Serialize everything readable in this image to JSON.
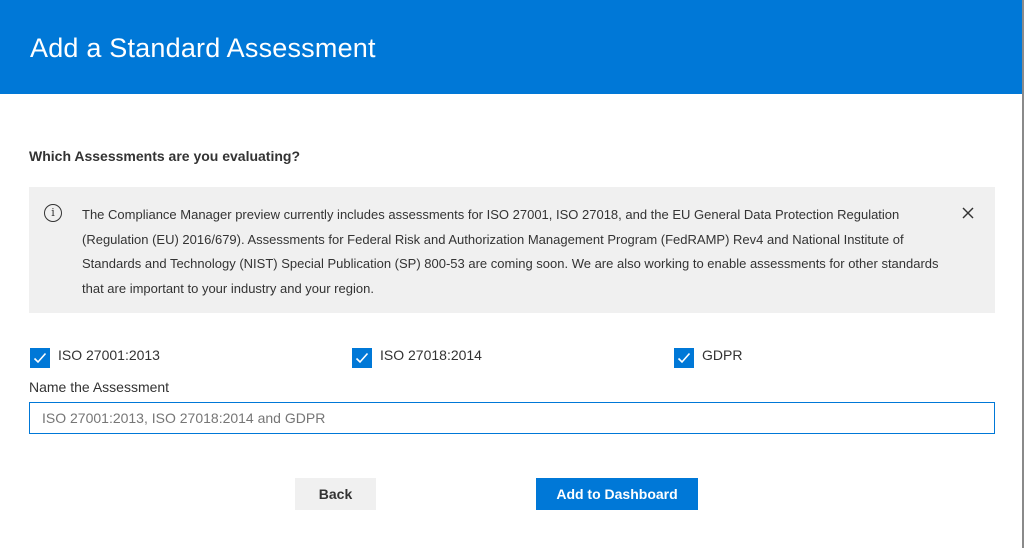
{
  "dialog": {
    "title": "Add a Standard Assessment"
  },
  "question": "Which Assessments are you evaluating?",
  "info_banner": {
    "icon": "info-icon",
    "text": "The Compliance Manager preview currently includes assessments for ISO 27001, ISO 27018, and the EU General Data Protection Regulation (Regulation (EU) 2016/679). Assessments for Federal Risk and Authorization Management Program (FedRAMP) Rev4 and National Institute of Standards and Technology (NIST) Special Publication (SP) 800-53 are coming soon. We are also working to enable assessments for other standards that are important to your industry and your region.",
    "close_icon": "close-icon"
  },
  "assessments": [
    {
      "label": "ISO 27001:2013",
      "checked": true
    },
    {
      "label": "ISO 27018:2014",
      "checked": true
    },
    {
      "label": "GDPR",
      "checked": true
    }
  ],
  "name_field": {
    "label": "Name the Assessment",
    "placeholder": "ISO 27001:2013, ISO 27018:2014 and GDPR",
    "value": ""
  },
  "buttons": {
    "back_label": "Back",
    "add_label": "Add to Dashboard"
  },
  "colors": {
    "accent": "#0078d7",
    "panel": "#f0f0f0",
    "text": "#333333"
  }
}
